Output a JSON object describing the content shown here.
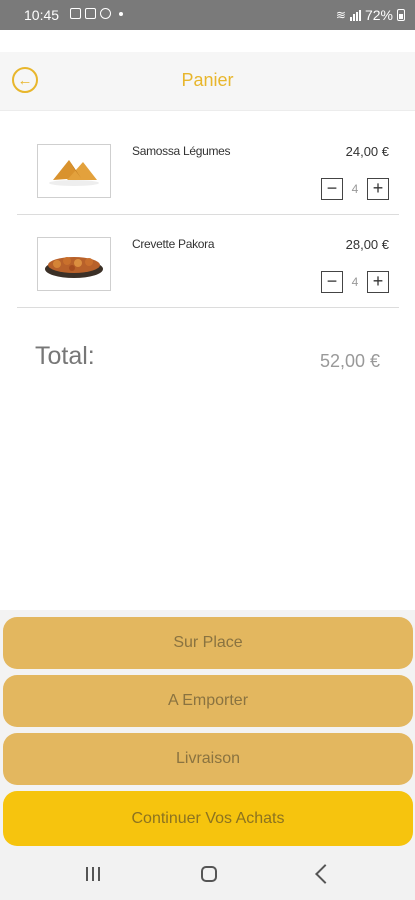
{
  "status_bar": {
    "time": "10:45",
    "battery": "72%"
  },
  "header": {
    "title": "Panier"
  },
  "cart": {
    "items": [
      {
        "name": "Samossa Légumes",
        "price": "24,00 €",
        "quantity": "4"
      },
      {
        "name": "Crevette Pakora",
        "price": "28,00 €",
        "quantity": "4"
      }
    ],
    "total_label": "Total:",
    "total_value": "52,00 €"
  },
  "actions": {
    "sur_place": "Sur Place",
    "a_emporter": "A Emporter",
    "livraison": "Livraison",
    "continuer": "Continuer Vos Achats"
  },
  "colors": {
    "accent": "#e8b62c",
    "button": "#e3b75f",
    "button_primary": "#f6c40e"
  }
}
